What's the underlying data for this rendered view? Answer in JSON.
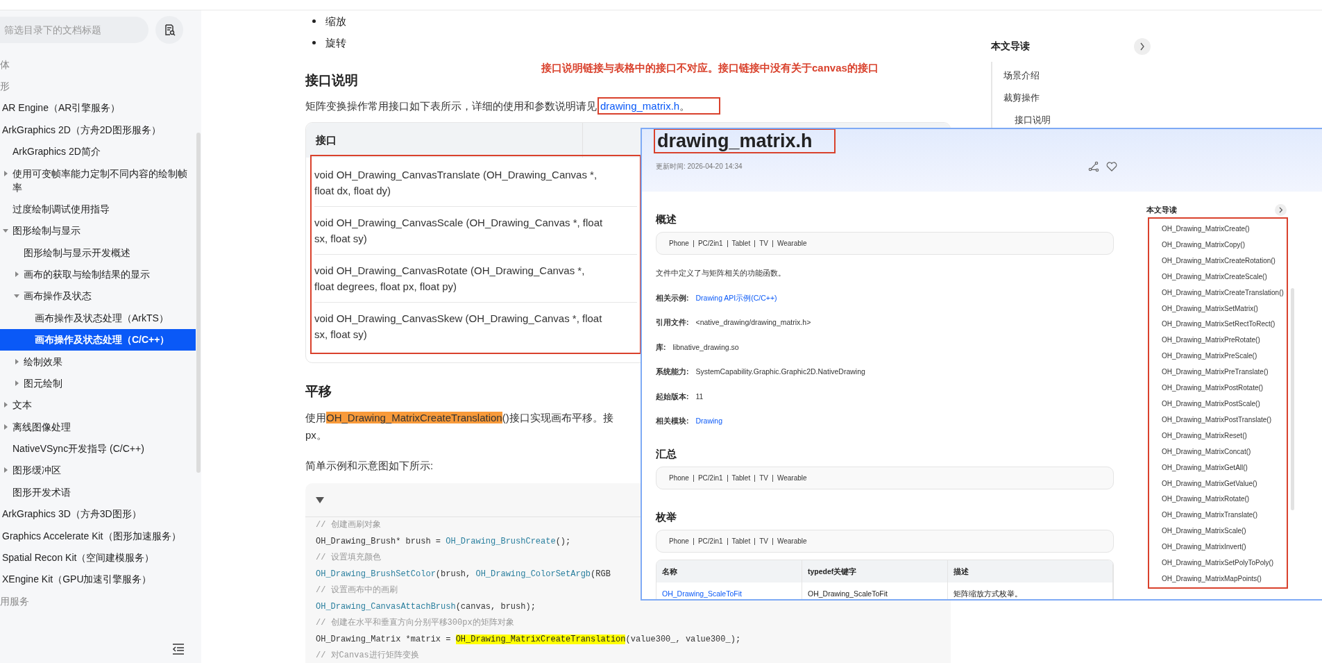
{
  "sidebar": {
    "search": {
      "placeholder": "筛选目录下的文档标题"
    },
    "items": [
      {
        "label": "体",
        "kind": "group",
        "selected": false
      },
      {
        "label": "形",
        "kind": "group",
        "selected": false,
        "children": [
          {
            "label": "AR Engine（AR引擎服务）",
            "selected": false
          },
          {
            "label": "ArkGraphics 2D（方舟2D图形服务）",
            "selected": false,
            "children": [
              {
                "label": "ArkGraphics 2D简介",
                "selected": false
              },
              {
                "label": "使用可变帧率能力定制不同内容的绘制帧率",
                "expanded": false,
                "selected": false
              },
              {
                "label": "过度绘制调试使用指导",
                "selected": false
              },
              {
                "label": "图形绘制与显示",
                "expanded": true,
                "selected": false,
                "children": [
                  {
                    "label": "图形绘制与显示开发概述",
                    "selected": false
                  },
                  {
                    "label": "画布的获取与绘制结果的显示",
                    "expanded": false,
                    "selected": false
                  },
                  {
                    "label": "画布操作及状态",
                    "expanded": true,
                    "selected": false,
                    "children": [
                      {
                        "label": "画布操作及状态处理（ArkTS）",
                        "selected": false
                      },
                      {
                        "label": "画布操作及状态处理（C/C++）",
                        "selected": true
                      }
                    ]
                  },
                  {
                    "label": "绘制效果",
                    "expanded": false,
                    "selected": false
                  },
                  {
                    "label": "图元绘制",
                    "expanded": false,
                    "selected": false
                  }
                ]
              },
              {
                "label": "文本",
                "expanded": false,
                "selected": false
              },
              {
                "label": "离线图像处理",
                "expanded": false,
                "selected": false
              },
              {
                "label": "NativeVSync开发指导 (C/C++)",
                "selected": false
              },
              {
                "label": "图形缓冲区",
                "expanded": false,
                "selected": false
              },
              {
                "label": "图形开发术语",
                "selected": false
              }
            ]
          },
          {
            "label": "ArkGraphics 3D（方舟3D图形）",
            "selected": false
          },
          {
            "label": "Graphics Accelerate Kit（图形加速服务）",
            "selected": false
          },
          {
            "label": "Spatial Recon Kit（空间建模服务）",
            "selected": false
          },
          {
            "label": "XEngine Kit（GPU加速引擎服务）",
            "selected": false
          }
        ]
      },
      {
        "label": "用服务",
        "kind": "group",
        "selected": false
      }
    ]
  },
  "annotation_note": "接口说明链接与表格中的接口不对应。接口链接中没有关于canvas的接口",
  "article": {
    "bullets": [
      "缩放",
      "旋转"
    ],
    "api_section": {
      "heading": "接口说明",
      "text": "矩阵变换操作常用接口如下表所示，详细的使用和参数说明请见",
      "link": "drawing_matrix.h",
      "end": "。",
      "link_annotated": true,
      "table": {
        "columns": [
          "接口"
        ],
        "annotated": true,
        "rows": [
          "void OH_Drawing_CanvasTranslate (OH_Drawing_Canvas *, float dx, float dy)",
          "void OH_Drawing_CanvasScale (OH_Drawing_Canvas *, float sx, float sy)",
          "void OH_Drawing_CanvasRotate (OH_Drawing_Canvas *, float degrees, float px, float py)",
          "void OH_Drawing_CanvasSkew (OH_Drawing_Canvas *, float sx, float sy)"
        ]
      }
    },
    "translate_section": {
      "heading": "平移",
      "line1": {
        "before": "使用",
        "highlight": "OH_Drawing_MatrixCreateTranslation",
        "after": "()接口实现画布平移。接"
      },
      "line2": "px。",
      "intro": "简单示例和示意图如下所示:",
      "code": {
        "expanded": true,
        "lines": [
          [
            {
              "kind": "comment",
              "text": "// 创建画刷对象"
            }
          ],
          [
            {
              "kind": "plain",
              "text": "OH_Drawing_Brush* brush = "
            },
            {
              "kind": "fn",
              "text": "OH_Drawing_BrushCreate"
            },
            {
              "kind": "plain",
              "text": "();"
            }
          ],
          [
            {
              "kind": "comment",
              "text": "// 设置填充颜色"
            }
          ],
          [
            {
              "kind": "fn",
              "text": "OH_Drawing_BrushSetColor"
            },
            {
              "kind": "plain",
              "text": "(brush, "
            },
            {
              "kind": "fn",
              "text": "OH_Drawing_ColorSetArgb"
            },
            {
              "kind": "plain",
              "text": "(RGB"
            }
          ],
          [
            {
              "kind": "comment",
              "text": "// 设置画布中的画刷"
            }
          ],
          [
            {
              "kind": "fn",
              "text": "OH_Drawing_CanvasAttachBrush"
            },
            {
              "kind": "plain",
              "text": "(canvas, brush);"
            }
          ],
          [
            {
              "kind": "comment",
              "text": "// 创建在水平和垂直方向分别平移300px的矩阵对象"
            }
          ],
          [
            {
              "kind": "plain",
              "text": "OH_Drawing_Matrix *matrix = "
            },
            {
              "kind": "hl",
              "text": "OH_Drawing_MatrixCreateTranslation"
            },
            {
              "kind": "plain",
              "text": "(value300_, value300_);"
            }
          ],
          [
            {
              "kind": "comment",
              "text": "// 对Canvas进行矩阵变换"
            }
          ]
        ]
      }
    }
  },
  "toc": {
    "title": "本文导读",
    "items": [
      {
        "label": "场景介绍"
      },
      {
        "label": "裁剪操作",
        "children": [
          {
            "label": "接口说明"
          }
        ]
      }
    ]
  },
  "popup": {
    "title": "drawing_matrix.h",
    "title_annotated": true,
    "updated": "更新时间: 2026-04-20 14:34",
    "overview": {
      "heading": "概述",
      "devices": [
        "Phone",
        "PC/2in1",
        "Tablet",
        "TV",
        "Wearable"
      ],
      "description": "文件中定义了与矩阵相关的功能函数。",
      "facts": [
        {
          "label": "相关示例:",
          "value": "Drawing API示例(C/C++)",
          "kind": "link"
        },
        {
          "label": "引用文件:",
          "value": "<native_drawing/drawing_matrix.h>",
          "kind": "text"
        },
        {
          "label": "库:",
          "value": "libnative_drawing.so",
          "kind": "text"
        },
        {
          "label": "系统能力:",
          "value": "SystemCapability.Graphic.Graphic2D.NativeDrawing",
          "kind": "text"
        },
        {
          "label": "起始版本:",
          "value": "11",
          "kind": "text"
        },
        {
          "label": "相关模块:",
          "value": "Drawing",
          "kind": "link"
        }
      ]
    },
    "summary": {
      "heading": "汇总",
      "devices": [
        "Phone",
        "PC/2in1",
        "Tablet",
        "TV",
        "Wearable"
      ]
    },
    "enums": {
      "heading": "枚举",
      "devices": [
        "Phone",
        "PC/2in1",
        "Tablet",
        "TV",
        "Wearable"
      ],
      "table": {
        "columns": [
          "名称",
          "typedef关键字",
          "描述"
        ],
        "rows": [
          [
            "OH_Drawing_ScaleToFit",
            "OH_Drawing_ScaleToFit",
            "矩阵缩放方式枚举。"
          ]
        ]
      }
    },
    "nav": {
      "title": "本文导读",
      "annotated": true,
      "items": [
        "OH_Drawing_MatrixCreate()",
        "OH_Drawing_MatrixCopy()",
        "OH_Drawing_MatrixCreateRotation()",
        "OH_Drawing_MatrixCreateScale()",
        "OH_Drawing_MatrixCreateTranslation()",
        "OH_Drawing_MatrixSetMatrix()",
        "OH_Drawing_MatrixSetRectToRect()",
        "OH_Drawing_MatrixPreRotate()",
        "OH_Drawing_MatrixPreScale()",
        "OH_Drawing_MatrixPreTranslate()",
        "OH_Drawing_MatrixPostRotate()",
        "OH_Drawing_MatrixPostScale()",
        "OH_Drawing_MatrixPostTranslate()",
        "OH_Drawing_MatrixReset()",
        "OH_Drawing_MatrixConcat()",
        "OH_Drawing_MatrixGetAll()",
        "OH_Drawing_MatrixGetValue()",
        "OH_Drawing_MatrixRotate()",
        "OH_Drawing_MatrixTranslate()",
        "OH_Drawing_MatrixScale()",
        "OH_Drawing_MatrixInvert()",
        "OH_Drawing_MatrixSetPolyToPoly()",
        "OH_Drawing_MatrixMapPoints()"
      ]
    }
  }
}
